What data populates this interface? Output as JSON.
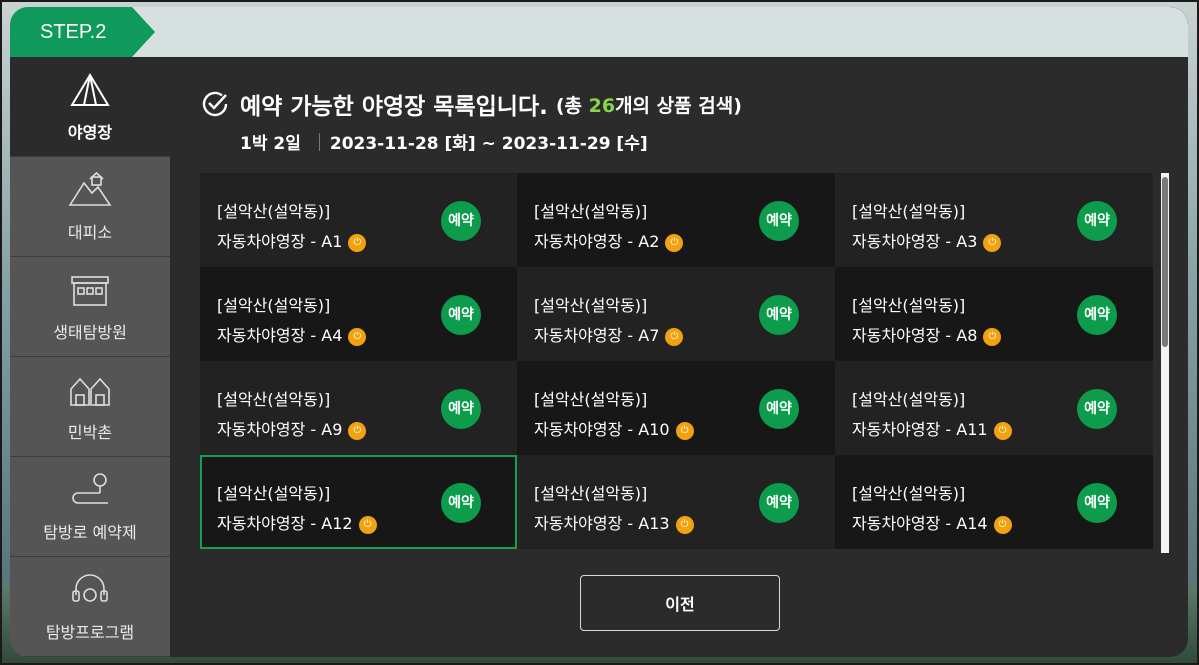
{
  "header": {
    "step": "STEP.2"
  },
  "sidebar": {
    "items": [
      {
        "label": "야영장",
        "icon": "tent-icon",
        "active": true
      },
      {
        "label": "대피소",
        "icon": "shelter-icon",
        "active": false
      },
      {
        "label": "생태탐방원",
        "icon": "eco-center-icon",
        "active": false
      },
      {
        "label": "민박촌",
        "icon": "houses-icon",
        "active": false
      },
      {
        "label": "탐방로 예약제",
        "icon": "trail-pin-icon",
        "active": false
      },
      {
        "label": "탐방프로그램",
        "icon": "headset-icon",
        "active": false
      }
    ]
  },
  "main": {
    "title": "예약 가능한 야영장 목록입니다.",
    "count_prefix": "(총 ",
    "count": "26",
    "count_suffix": "개의 상품 검색)",
    "nights": "1박 2일",
    "date_range": "2023-11-28 [화] ~ 2023-11-29 [수]"
  },
  "sites": [
    {
      "location": "[설악산(설악동)]",
      "name": "자동차야영장 - A1",
      "button": "예약"
    },
    {
      "location": "[설악산(설악동)]",
      "name": "자동차야영장 - A2",
      "button": "예약"
    },
    {
      "location": "[설악산(설악동)]",
      "name": "자동차야영장 - A3",
      "button": "예약"
    },
    {
      "location": "[설악산(설악동)]",
      "name": "자동차야영장 - A4",
      "button": "예약"
    },
    {
      "location": "[설악산(설악동)]",
      "name": "자동차야영장 - A7",
      "button": "예약"
    },
    {
      "location": "[설악산(설악동)]",
      "name": "자동차야영장 - A8",
      "button": "예약"
    },
    {
      "location": "[설악산(설악동)]",
      "name": "자동차야영장 - A9",
      "button": "예약"
    },
    {
      "location": "[설악산(설악동)]",
      "name": "자동차야영장 - A10",
      "button": "예약"
    },
    {
      "location": "[설악산(설악동)]",
      "name": "자동차야영장 - A11",
      "button": "예약"
    },
    {
      "location": "[설악산(설악동)]",
      "name": "자동차야영장 - A12",
      "button": "예약",
      "selected": true
    },
    {
      "location": "[설악산(설악동)]",
      "name": "자동차야영장 - A13",
      "button": "예약"
    },
    {
      "location": "[설악산(설악동)]",
      "name": "자동차야영장 - A14",
      "button": "예약"
    }
  ],
  "footer": {
    "prev_label": "이전"
  },
  "colors": {
    "accent": "#0f9a5b",
    "count": "#8bd34b",
    "electric": "#f2a20f"
  }
}
